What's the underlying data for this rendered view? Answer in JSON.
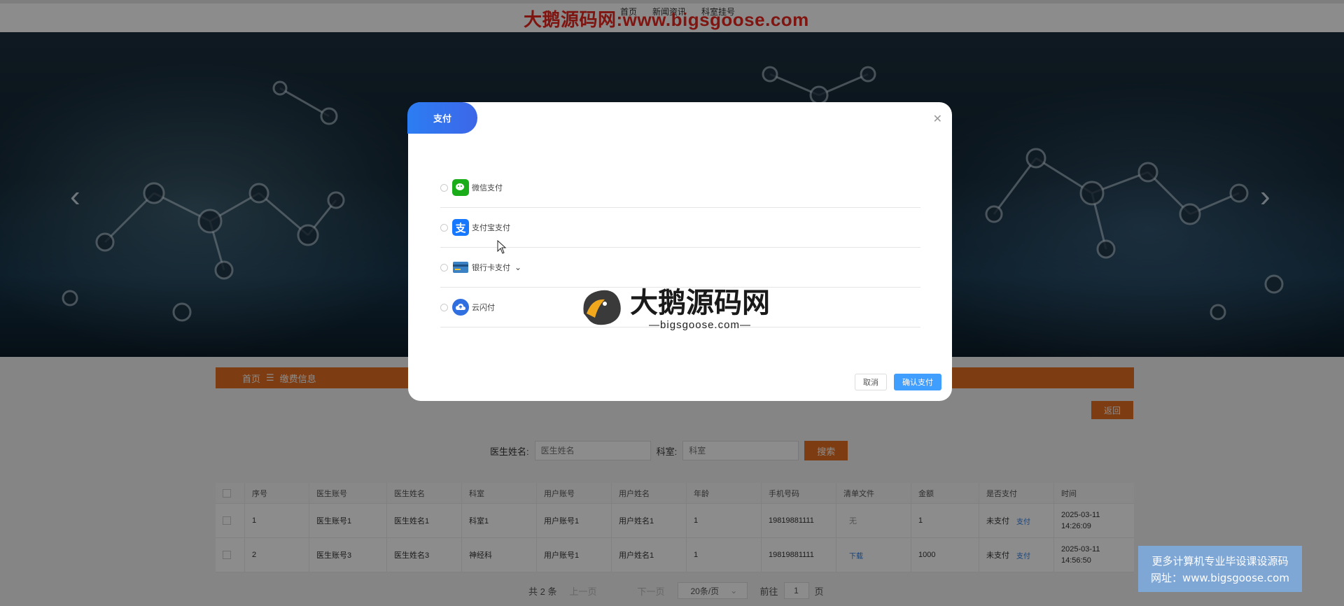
{
  "topnav": {
    "items": [
      "首页",
      "新闻资讯",
      "科室挂号"
    ]
  },
  "watermark": {
    "site": "大鹅源码网:www.bigsgoose.com"
  },
  "banner": {
    "prev_icon": "chevron-left-icon",
    "next_icon": "chevron-right-icon"
  },
  "breadcrumb": {
    "home": "首页",
    "separator": "☰",
    "current": "缴费信息"
  },
  "back_button": "返回",
  "search": {
    "doctor_label": "医生姓名:",
    "doctor_placeholder": "医生姓名",
    "dept_label": "科室:",
    "dept_placeholder": "科室",
    "button": "搜索"
  },
  "table": {
    "headers": [
      "序号",
      "医生账号",
      "医生姓名",
      "科室",
      "用户账号",
      "用户姓名",
      "年龄",
      "手机号码",
      "清单文件",
      "金额",
      "是否支付",
      "时间"
    ],
    "rows": [
      {
        "index": "1",
        "doctor_account": "医生账号1",
        "doctor_name": "医生姓名1",
        "dept": "科室1",
        "user_account": "用户账号1",
        "user_name": "用户姓名1",
        "age": "1",
        "phone": "19819881111",
        "file": "无",
        "amount": "1",
        "paid": "未支付",
        "pay_action": "支付",
        "time": "2025-03-11 14:26:09"
      },
      {
        "index": "2",
        "doctor_account": "医生账号3",
        "doctor_name": "医生姓名3",
        "dept": "神经科",
        "user_account": "用户账号1",
        "user_name": "用户姓名1",
        "age": "1",
        "phone": "19819881111",
        "file": "下载",
        "amount": "1000",
        "paid": "未支付",
        "pay_action": "支付",
        "time": "2025-03-11 14:56:50"
      }
    ]
  },
  "pager": {
    "total": "共 2 条",
    "prev": "上一页",
    "next": "下一页",
    "size": "20条/页",
    "goto": "前往",
    "page": "1",
    "page_unit": "页"
  },
  "modal": {
    "title": "支付",
    "close_icon": "close-icon",
    "options": [
      {
        "label": "微信支付",
        "icon": "wechat-pay-icon",
        "color": "#1aad19"
      },
      {
        "label": "支付宝支付",
        "icon": "alipay-icon",
        "color": "#1677ff"
      },
      {
        "label": "银行卡支付",
        "icon": "bank-card-icon",
        "color": "#3b82c4"
      },
      {
        "label": "云闪付",
        "icon": "cloud-pay-icon",
        "color": "#2f6fe0"
      }
    ],
    "cancel": "取消",
    "confirm": "确认支付"
  },
  "brand_logo": {
    "name": "大鹅源码网",
    "domain": "—bigsgoose.com—"
  },
  "ad": {
    "line1": "更多计算机专业毕设课设源码",
    "line2": "网址：www.bigsgoose.com"
  }
}
